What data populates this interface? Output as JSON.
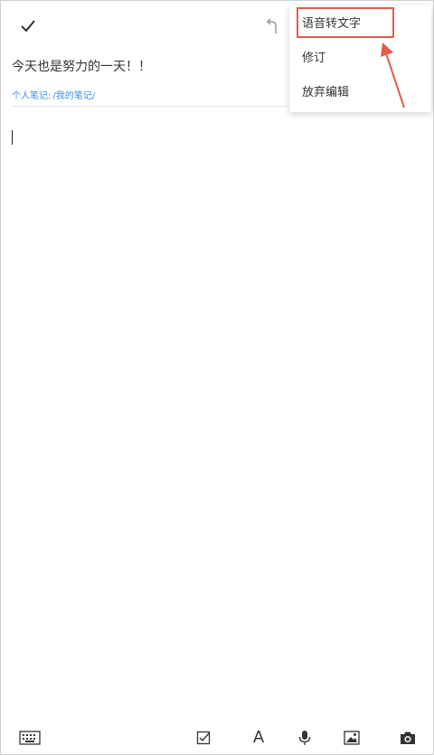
{
  "note": {
    "title": "今天也是努力的一天！！",
    "path_label": "个人笔记:",
    "path_value": "/我的笔记/"
  },
  "menu": {
    "items": [
      {
        "label": "语音转文字"
      },
      {
        "label": "修订"
      },
      {
        "label": "放弃编辑"
      }
    ]
  },
  "toolbar": {
    "font_button_label": "A"
  },
  "colors": {
    "highlight": "#e35b4b",
    "path_link": "#3a8ee6"
  },
  "icons": [
    "check-icon",
    "undo-icon",
    "keyboard-icon",
    "checkbox-icon",
    "microphone-icon",
    "image-icon",
    "camera-icon"
  ]
}
